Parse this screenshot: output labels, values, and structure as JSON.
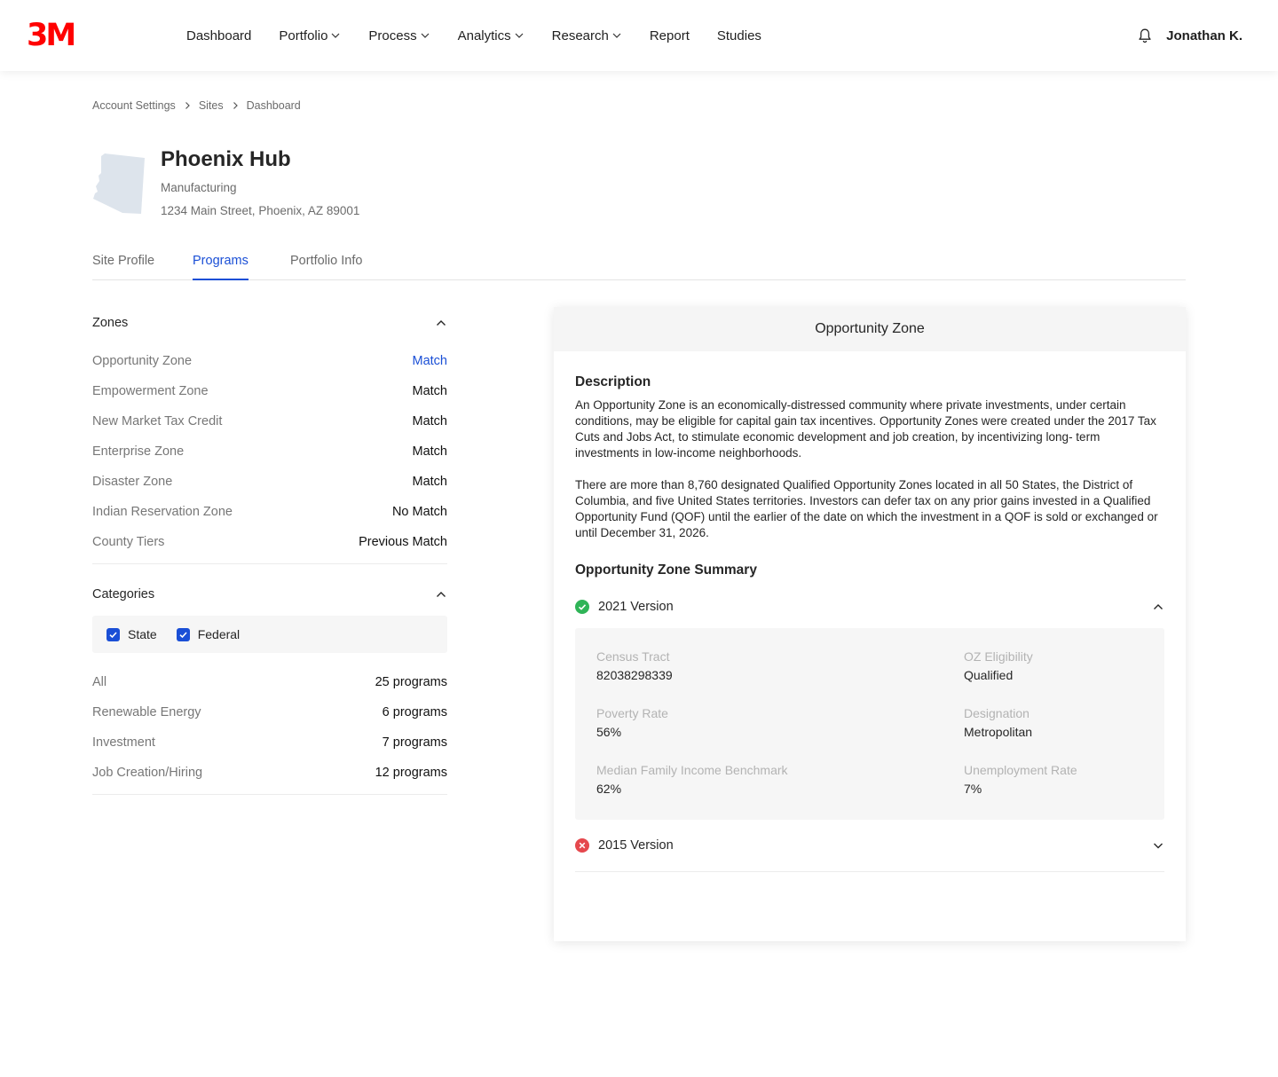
{
  "brand": {
    "logo_text": "3M",
    "logo_color": "#ff0000"
  },
  "nav": {
    "items": [
      {
        "label": "Dashboard",
        "has_dropdown": false
      },
      {
        "label": "Portfolio",
        "has_dropdown": true
      },
      {
        "label": "Process",
        "has_dropdown": true
      },
      {
        "label": "Analytics",
        "has_dropdown": true
      },
      {
        "label": "Research",
        "has_dropdown": true
      },
      {
        "label": "Report",
        "has_dropdown": false
      },
      {
        "label": "Studies",
        "has_dropdown": false
      }
    ],
    "notification_icon": "bell-icon",
    "user_name": "Jonathan K."
  },
  "breadcrumb": [
    "Account Settings",
    "Sites",
    "Dashboard"
  ],
  "site": {
    "title": "Phoenix Hub",
    "type": "Manufacturing",
    "address": "1234 Main Street, Phoenix, AZ 89001",
    "map_icon": "arizona-state-map-icon"
  },
  "tabs": [
    {
      "label": "Site Profile",
      "active": false
    },
    {
      "label": "Programs",
      "active": true
    },
    {
      "label": "Portfolio Info",
      "active": false
    }
  ],
  "zones": {
    "title": "Zones",
    "expanded": true,
    "rows": [
      {
        "label": "Opportunity Zone",
        "value": "Match",
        "selected": true
      },
      {
        "label": "Empowerment Zone",
        "value": "Match",
        "selected": false
      },
      {
        "label": "New Market Tax Credit",
        "value": "Match",
        "selected": false
      },
      {
        "label": "Enterprise Zone",
        "value": "Match",
        "selected": false
      },
      {
        "label": "Disaster Zone",
        "value": "Match",
        "selected": false
      },
      {
        "label": "Indian Reservation Zone",
        "value": "No Match",
        "selected": false
      },
      {
        "label": "County Tiers",
        "value": "Previous Match",
        "selected": false
      }
    ]
  },
  "categories": {
    "title": "Categories",
    "expanded": true,
    "filters": [
      {
        "label": "State",
        "checked": true
      },
      {
        "label": "Federal",
        "checked": true
      }
    ],
    "rows": [
      {
        "label": "All",
        "value": "25 programs"
      },
      {
        "label": "Renewable Energy",
        "value": "6 programs"
      },
      {
        "label": "Investment",
        "value": "7 programs"
      },
      {
        "label": "Job Creation/Hiring",
        "value": "12 programs"
      }
    ]
  },
  "detail": {
    "title": "Opportunity Zone",
    "description_title": "Description",
    "description_paragraphs": [
      "An Opportunity Zone is an economically-distressed community where private investments, under certain conditions, may be eligible for capital gain tax incentives. Opportunity Zones were created under the 2017 Tax Cuts and Jobs Act, to stimulate economic development and job creation, by incentivizing long- term investments in low-income neighborhoods.",
      "There are more than 8,760 designated Qualified Opportunity Zones located in all 50 States, the District of Columbia, and five United States territories. Investors can defer tax on any prior gains invested in a Qualified Opportunity Fund (QOF) until the earlier of the date on which the investment in a QOF is sold or exchanged or until December 31, 2026."
    ],
    "summary_title": "Opportunity Zone Summary",
    "versions": [
      {
        "label": "2021 Version",
        "status": "eligible",
        "status_icon": "check-circle-icon",
        "expanded": true,
        "fields": [
          {
            "label": "Census Tract",
            "value": "82038298339"
          },
          {
            "label": "OZ Eligibility",
            "value": "Qualified"
          },
          {
            "label": "Poverty Rate",
            "value": "56%"
          },
          {
            "label": "Designation",
            "value": "Metropolitan"
          },
          {
            "label": "Median Family Income Benchmark",
            "value": "62%"
          },
          {
            "label": "Unemployment Rate",
            "value": "7%"
          }
        ]
      },
      {
        "label": "2015 Version",
        "status": "not-eligible",
        "status_icon": "x-circle-icon",
        "expanded": false
      }
    ]
  },
  "colors": {
    "accent": "#1a4fd6",
    "success": "#2fb457",
    "error": "#e5484d",
    "muted_text": "#6b6b6b"
  }
}
